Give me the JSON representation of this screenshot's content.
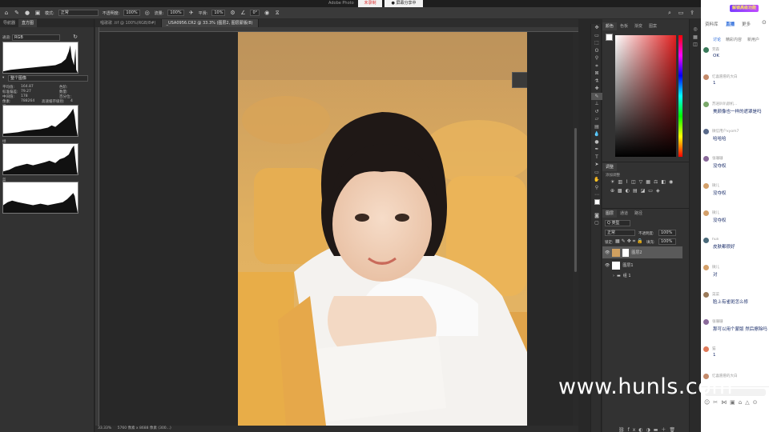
{
  "titlebar": {
    "app_title": "Adobe Photo",
    "recording_label": "未录制",
    "screen_share_label": "屏幕分享中"
  },
  "options_bar": {
    "mode_label": "模式:",
    "mode_value": "正常",
    "opacity_label": "不透明度:",
    "opacity_value": "100%",
    "flow_label": "流量:",
    "flow_value": "100%",
    "smooth_label": "平滑:",
    "smooth_value": "10%",
    "angle_value": "0°"
  },
  "left_panel": {
    "tabs": [
      "导航器",
      "直方图"
    ],
    "channel_label": "通道:",
    "channel_value": "RGB",
    "source_value": "整个图像",
    "stats_left": [
      {
        "label": "平均值:",
        "value": "164.87"
      },
      {
        "label": "标准偏差:",
        "value": "79.27"
      },
      {
        "label": "中间值:",
        "value": "178"
      },
      {
        "label": "像素:",
        "value": "788264"
      }
    ],
    "stats_right": [
      {
        "label": "色阶:"
      },
      {
        "label": "数量:"
      },
      {
        "label": "百分位:"
      },
      {
        "label": "高速缓存级别:",
        "value": "4"
      }
    ],
    "channel_labels": [
      "红",
      "绿",
      "蓝"
    ]
  },
  "document_tabs": [
    {
      "label": "唱歌歌 .tif @ 100%(RGB/8#)"
    },
    {
      "label": "_USA0956.CR2 @ 33.3% (图层2, 图层蒙版/8)",
      "active": true
    }
  ],
  "status_bar": {
    "zoom": "33.33%",
    "dimensions": "5760 像素 x 8688 像素 (300...)"
  },
  "right_panel": {
    "color_tabs": [
      "颜色",
      "色板",
      "渐变",
      "图案"
    ],
    "adjust_tabs": [
      "调整"
    ],
    "adjust_label": "添加调整",
    "layers_tabs": [
      "图层",
      "通道",
      "路径"
    ],
    "filter_label": "Q 类型",
    "blend_mode": "正常",
    "opacity_label": "不透明度:",
    "opacity_value": "100%",
    "lock_label": "锁定:",
    "fill_label": "填充:",
    "fill_value": "100%",
    "layers": [
      {
        "name": "图层2",
        "selected": true
      },
      {
        "name": "图层1",
        "selected": false
      },
      {
        "name": "组 1",
        "selected": false
      }
    ]
  },
  "chat": {
    "banner": "解锁高级功能",
    "tabs": [
      "资料库",
      "直播",
      "更多"
    ],
    "subtabs": [
      "讨论",
      "精彩内容",
      "新用户"
    ],
    "messages": [
      {
        "user": "劳森",
        "text": "OK",
        "color": "#3a7a5a"
      },
      {
        "user": "忆喜愿愿的大白",
        "text": "1",
        "color": "#c48a6a"
      },
      {
        "user": "苏逍叭叭颜机...",
        "text": "美颜像也一样的遮罩是吗",
        "color": "#7aa86a"
      },
      {
        "user": "微信用户xyom7",
        "text": "哈哈哈",
        "color": "#5a6a8a"
      },
      {
        "user": "张珊珊",
        "text": "没夺权",
        "color": "#8a6a9a"
      },
      {
        "user": "微儿",
        "text": "没夺权",
        "color": "#d4a06a"
      },
      {
        "user": "微儿",
        "text": "没夺权",
        "color": "#d4a06a"
      },
      {
        "user": "huli",
        "text": "皮肤都很好",
        "color": "#4a6a7a"
      },
      {
        "user": "微儿",
        "text": "对",
        "color": "#d4a06a"
      },
      {
        "user": "菜菜",
        "text": "脸上有雀斑怎么修",
        "color": "#9a7a5a"
      },
      {
        "user": "张珊珊",
        "text": "那可以用个蒙版 然后擦除吗",
        "color": "#8a6a9a"
      },
      {
        "user": "猫",
        "text": "1",
        "color": "#e07a5a"
      },
      {
        "user": "忆喜愿愿的大白",
        "text": "",
        "color": "#c48a6a"
      }
    ]
  },
  "watermark": "www.hunls.com"
}
